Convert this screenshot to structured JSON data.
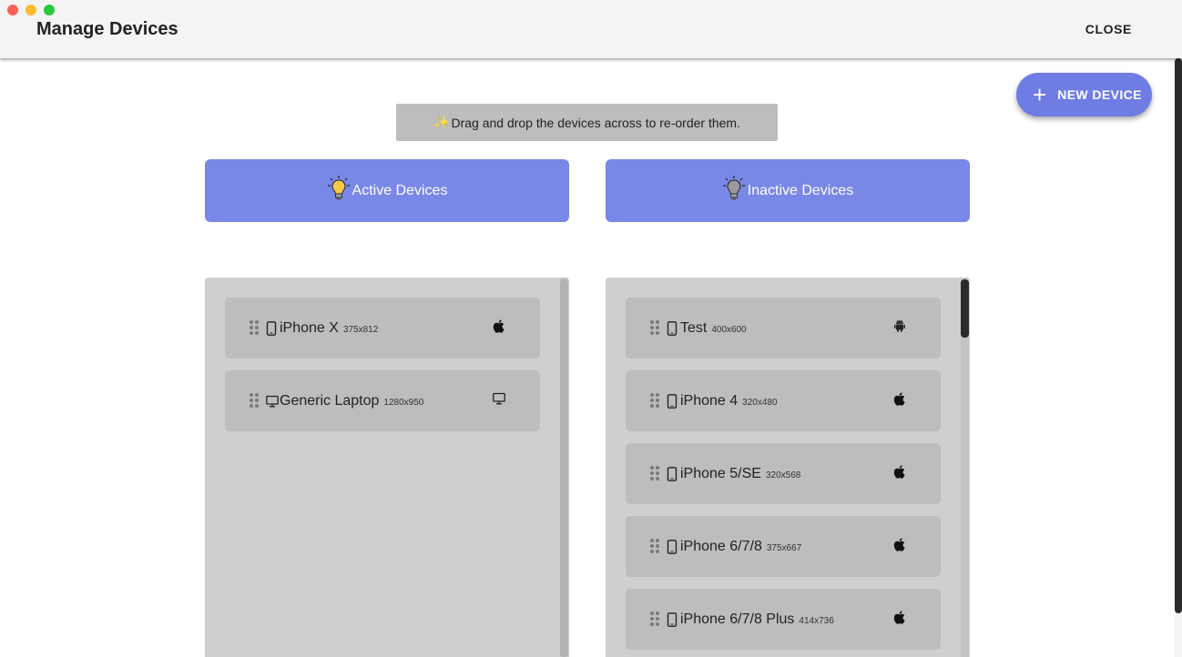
{
  "window": {
    "title": "Manage Devices",
    "close_label": "CLOSE"
  },
  "fab": {
    "label": "NEW DEVICE"
  },
  "hint": {
    "sparkle": "✨",
    "text": "Drag and drop the devices across to re-order them."
  },
  "columns": {
    "active": {
      "title": "Active Devices"
    },
    "inactive": {
      "title": "Inactive Devices"
    }
  },
  "active_devices": [
    {
      "name": "iPhone X",
      "resolution": "375x812",
      "device_icon": "mobile-icon",
      "os_icon": "apple-icon"
    },
    {
      "name": "Generic Laptop",
      "resolution": "1280x950",
      "device_icon": "desktop-icon",
      "os_icon": "desktop-icon"
    }
  ],
  "inactive_devices": [
    {
      "name": "Test",
      "resolution": "400x600",
      "device_icon": "mobile-icon",
      "os_icon": "android-icon"
    },
    {
      "name": "iPhone 4",
      "resolution": "320x480",
      "device_icon": "mobile-icon",
      "os_icon": "apple-icon"
    },
    {
      "name": "iPhone 5/SE",
      "resolution": "320x568",
      "device_icon": "mobile-icon",
      "os_icon": "apple-icon"
    },
    {
      "name": "iPhone 6/7/8",
      "resolution": "375x667",
      "device_icon": "mobile-icon",
      "os_icon": "apple-icon"
    },
    {
      "name": "iPhone 6/7/8 Plus",
      "resolution": "414x736",
      "device_icon": "mobile-icon",
      "os_icon": "apple-icon"
    }
  ],
  "colors": {
    "accent": "#6e7ce4",
    "header": "#7988e6",
    "list_bg": "#cfcfcf",
    "card_bg": "#bdbdbd"
  }
}
